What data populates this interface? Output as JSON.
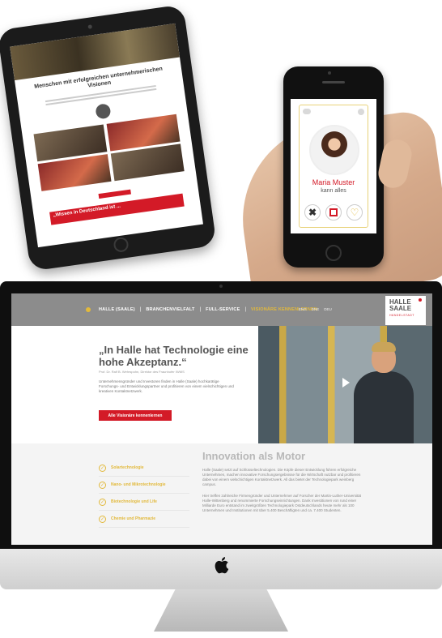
{
  "tablet": {
    "headline": "Menschen mit erfolgreichen unternehmerischen Visionen",
    "banner": "„Wissen in Deutschland ist ..."
  },
  "phone": {
    "profile_name": "Maria Muster",
    "profile_role": "kann alles",
    "actions": {
      "reject": "✖",
      "heart": "♡"
    }
  },
  "website": {
    "nav": {
      "items": [
        "HALLE (SAALE)",
        "BRANCHENVIELFALT",
        "FULL-SERVICE",
        "VISIONÄRE KENNENLERNEN"
      ],
      "separator": "|",
      "langs": [
        "ENG",
        "DNE",
        "DEU"
      ]
    },
    "logo": {
      "line1": "HALLE",
      "line2": "SAALE",
      "tagline": "HÄNDELSTADT"
    },
    "hero": {
      "quote": "„In Halle hat Technologie eine hohe Akzeptanz.“",
      "quote_author": "Prof. Dr. Ralf B. Wehrspohn, Direktor des Fraunhofer IWMS",
      "text": "Unternehmensgründer und Investoren finden in Halle (Saale) hochkarätige Forschungs- und Entwicklungspartner und profitieren von einem vielschichtigen und kreativen Kontaktnetzwerk.",
      "cta": "Alle Visionäre kennenlernen"
    },
    "innovation": {
      "title": "Innovation als Motor",
      "p1": "Halle (Saale) setzt auf Schlüsseltechnologien. Die Köpfe dieser Entwicklung führen erfolgreiche Unternehmen, machen innovative Forschungsergebnisse für die Wirtschaft nutzbar und profitieren dabei von einem vielschichtigen Kontaktnetzwerk. All das bietet der Technologiepark weinberg campus.",
      "p2": "Hier treffen zahlreiche Firmengründer und Unternehmer auf Forscher der Martin-Luther-Universität Halle-Wittenberg und renommierte Forschungseinrichtungen. Dank Investitionen von rund einer Milliarde Euro entstand im zweitgrößten Technologiepark Ostdeutschlands heute mehr als 100 Unternehmen und Institutionen mit über 5.400 Beschäftigten und ca. 7.400 Studenten."
    },
    "tech_list": [
      "Solartechnologie",
      "Nano- und Mikrotechnologie",
      "Biotechnologie und Life",
      "Chemie und Pharmazie"
    ],
    "check_glyph": "✓"
  },
  "colors": {
    "brand_red": "#d31a27",
    "accent_gold": "#e2b93b",
    "nav_gray": "#8c8c8c"
  }
}
